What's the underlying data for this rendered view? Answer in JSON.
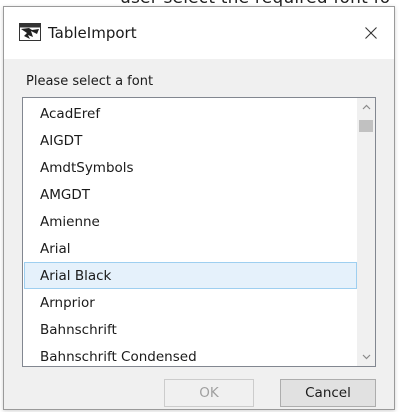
{
  "background_caption": "user select the required font fo",
  "window": {
    "title": "TableImport",
    "close_glyph": "×",
    "app_icon": "tableimport-app-icon"
  },
  "prompt": "Please select a font",
  "font_list": {
    "items": [
      "AcadEref",
      "AIGDT",
      "AmdtSymbols",
      "AMGDT",
      "Amienne",
      "Arial",
      "Arial Black",
      "Arnprior",
      "Bahnschrift",
      "Bahnschrift Condensed"
    ],
    "selected": "Arial Black"
  },
  "buttons": {
    "ok_label": "OK",
    "ok_enabled": false,
    "cancel_label": "Cancel"
  },
  "colors": {
    "selection_fill": "#e5f1fb",
    "selection_border": "#9ecff0",
    "dialog_bg": "#f0f0f0"
  }
}
